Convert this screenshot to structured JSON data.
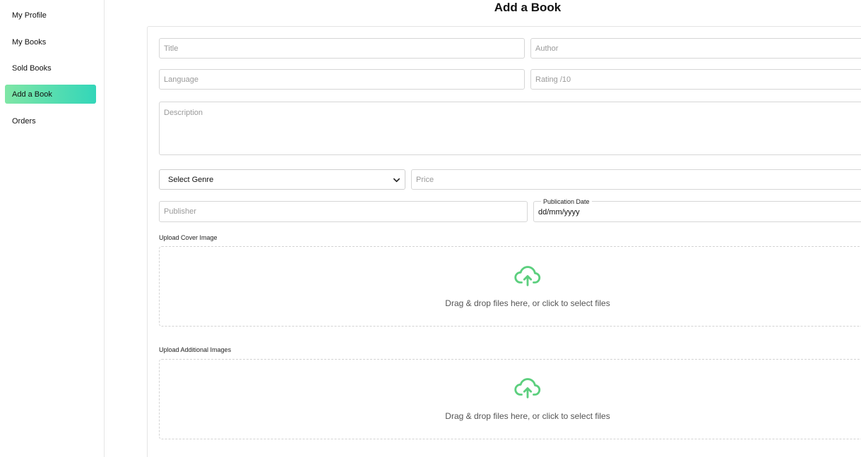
{
  "sidebar": {
    "items": [
      {
        "label": "My Profile"
      },
      {
        "label": "My Books"
      },
      {
        "label": "Sold Books"
      },
      {
        "label": "Add a Book",
        "active": true
      },
      {
        "label": "Orders"
      }
    ]
  },
  "page": {
    "title": "Add a Book"
  },
  "form": {
    "title_placeholder": "Title",
    "author_placeholder": "Author",
    "language_placeholder": "Language",
    "rating_placeholder": "Rating /10",
    "description_placeholder": "Description",
    "genre_selected": "Select Genre",
    "price_placeholder": "Price",
    "publisher_placeholder": "Publisher",
    "publication_date_label": "Publication Date",
    "publication_date_value": "dd/mm/yyyy"
  },
  "uploads": {
    "cover_label": "Upload Cover Image",
    "additional_label": "Upload Additional Images",
    "dropzone_text": "Drag & drop files here, or click to select files",
    "icon": "cloud-upload-icon"
  },
  "colors": {
    "active_gradient_start": "#7fe6a6",
    "active_gradient_end": "#33d6b9",
    "upload_icon": "#5ccf7e"
  }
}
